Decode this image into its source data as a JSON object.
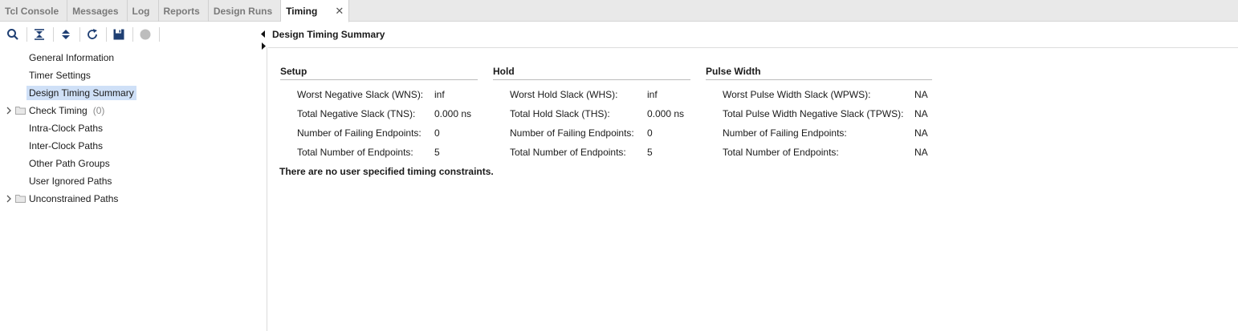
{
  "tabs": [
    {
      "label": "Tcl Console"
    },
    {
      "label": "Messages"
    },
    {
      "label": "Log"
    },
    {
      "label": "Reports"
    },
    {
      "label": "Design Runs"
    },
    {
      "label": "Timing",
      "active": true
    }
  ],
  "toolbar": {
    "icons": [
      "search-icon",
      "collapse-all-icon",
      "expand-all-icon",
      "refresh-icon",
      "save-icon",
      "stop-icon"
    ]
  },
  "tree": {
    "items": [
      {
        "label": "General Information"
      },
      {
        "label": "Timer Settings"
      },
      {
        "label": "Design Timing Summary",
        "selected": true
      },
      {
        "label": "Check Timing",
        "count": "(0)",
        "expandable": true
      },
      {
        "label": "Intra-Clock Paths"
      },
      {
        "label": "Inter-Clock Paths"
      },
      {
        "label": "Other Path Groups"
      },
      {
        "label": "User Ignored Paths"
      },
      {
        "label": "Unconstrained Paths",
        "expandable": true
      }
    ]
  },
  "panel": {
    "title": "Design Timing Summary",
    "note": "There are no user specified timing constraints."
  },
  "setup": {
    "title": "Setup",
    "rows": [
      {
        "label": "Worst Negative Slack (WNS):",
        "value": "inf"
      },
      {
        "label": "Total Negative Slack (TNS):",
        "value": "0.000 ns"
      },
      {
        "label": "Number of Failing Endpoints:",
        "value": "0"
      },
      {
        "label": "Total Number of Endpoints:",
        "value": "5"
      }
    ]
  },
  "hold": {
    "title": "Hold",
    "rows": [
      {
        "label": "Worst Hold Slack (WHS):",
        "value": "inf"
      },
      {
        "label": "Total Hold Slack (THS):",
        "value": "0.000 ns"
      },
      {
        "label": "Number of Failing Endpoints:",
        "value": "0"
      },
      {
        "label": "Total Number of Endpoints:",
        "value": "5"
      }
    ]
  },
  "pulse": {
    "title": "Pulse Width",
    "rows": [
      {
        "label": "Worst Pulse Width Slack (WPWS):",
        "value": "NA"
      },
      {
        "label": "Total Pulse Width Negative Slack (TPWS):",
        "value": "NA"
      },
      {
        "label": "Number of Failing Endpoints:",
        "value": "NA"
      },
      {
        "label": "Total Number of Endpoints:",
        "value": "NA"
      }
    ]
  },
  "colors": {
    "selection": "#cfe0f7",
    "save_icon": "#1f3f73",
    "accent": "#2a5a9a"
  }
}
